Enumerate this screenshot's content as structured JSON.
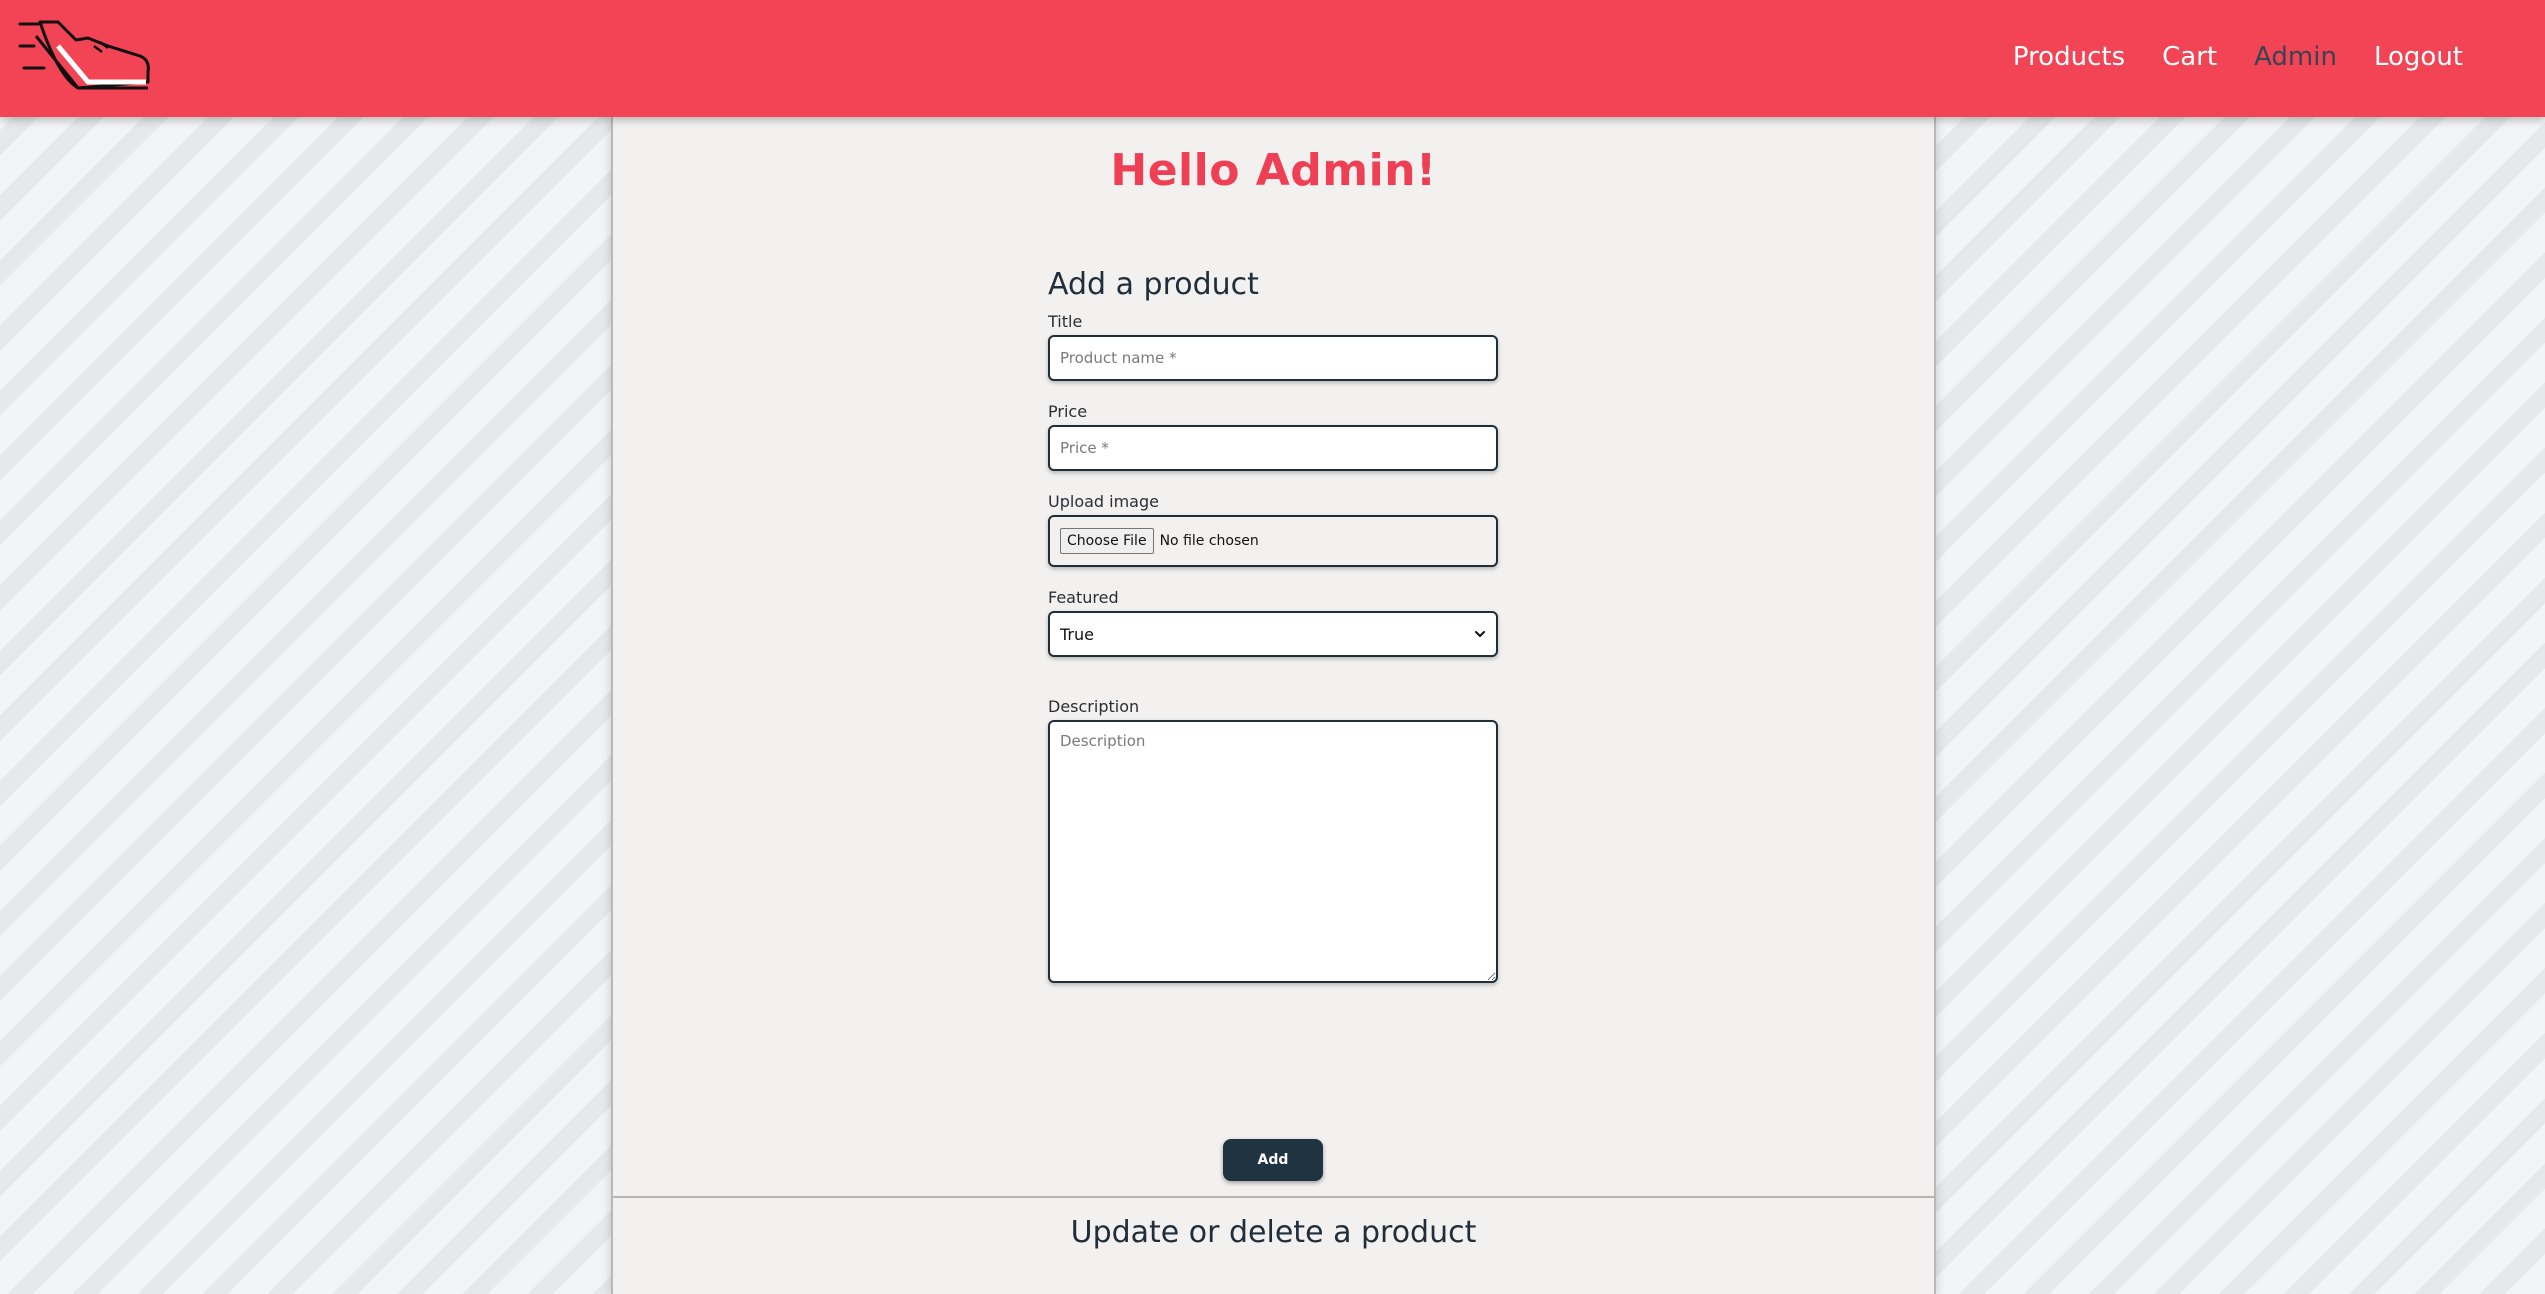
{
  "header": {
    "logo_icon": "running-shoe-icon",
    "brand_color": "#f24455",
    "nav": [
      {
        "label": "Products",
        "active": false
      },
      {
        "label": "Cart",
        "active": false
      },
      {
        "label": "Admin",
        "active": true
      },
      {
        "label": "Logout",
        "active": false
      }
    ]
  },
  "main": {
    "greeting": "Hello Admin!",
    "add_form": {
      "title": "Add a product",
      "title_label": "Title",
      "title_placeholder": "Product name *",
      "price_label": "Price",
      "price_placeholder": "Price *",
      "image_label": "Upload image",
      "choose_file_label": "Choose File",
      "no_file_text": "No file chosen",
      "featured_label": "Featured",
      "featured_value": "True",
      "description_label": "Description",
      "description_placeholder": "Description",
      "add_button": "Add"
    },
    "update_section_title": "Update or delete a product"
  },
  "colors": {
    "accent": "#f24455",
    "dark": "#1f3340",
    "panel": "#f2f1ef"
  }
}
